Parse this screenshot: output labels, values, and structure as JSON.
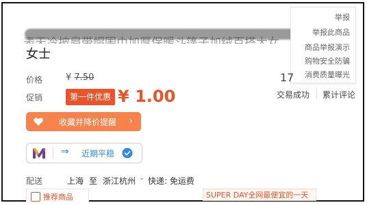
{
  "title": {
    "fragment": "表天冷披肩带帽围巾加厚保暖斗篷子加绒百搭大女",
    "line2": "女士"
  },
  "report_menu": {
    "items": [
      "举报",
      "举报此商品",
      "商品举报演示",
      "购物安全防骗",
      "消费质量曝光"
    ]
  },
  "price": {
    "label": "价格",
    "currency": "¥",
    "original": "7.50",
    "sold_count_partial": "17"
  },
  "promo": {
    "label": "促销",
    "badge": "第一件优惠",
    "currency": "¥",
    "price": "1.00"
  },
  "stats": {
    "deals_label": "交易成功",
    "reviews_label": "累计评论"
  },
  "favorite_button": {
    "label": "收藏并降价提醒",
    "arrow": "›"
  },
  "trend": {
    "label": "近期平稳",
    "arrow": "⇒"
  },
  "shipping": {
    "label": "配送",
    "from": "上海",
    "to_word": "至",
    "dest": "浙江杭州",
    "chevron": "⌄",
    "method": "快递: 免运费"
  },
  "bottom": {
    "recommend_label": "推荐商品",
    "super_day": "SUPER DAY全网最便宜的一天"
  },
  "colors": {
    "accent": "#e9542a",
    "button_orange": "#f6824c",
    "trend_blue": "#2f87e8"
  }
}
